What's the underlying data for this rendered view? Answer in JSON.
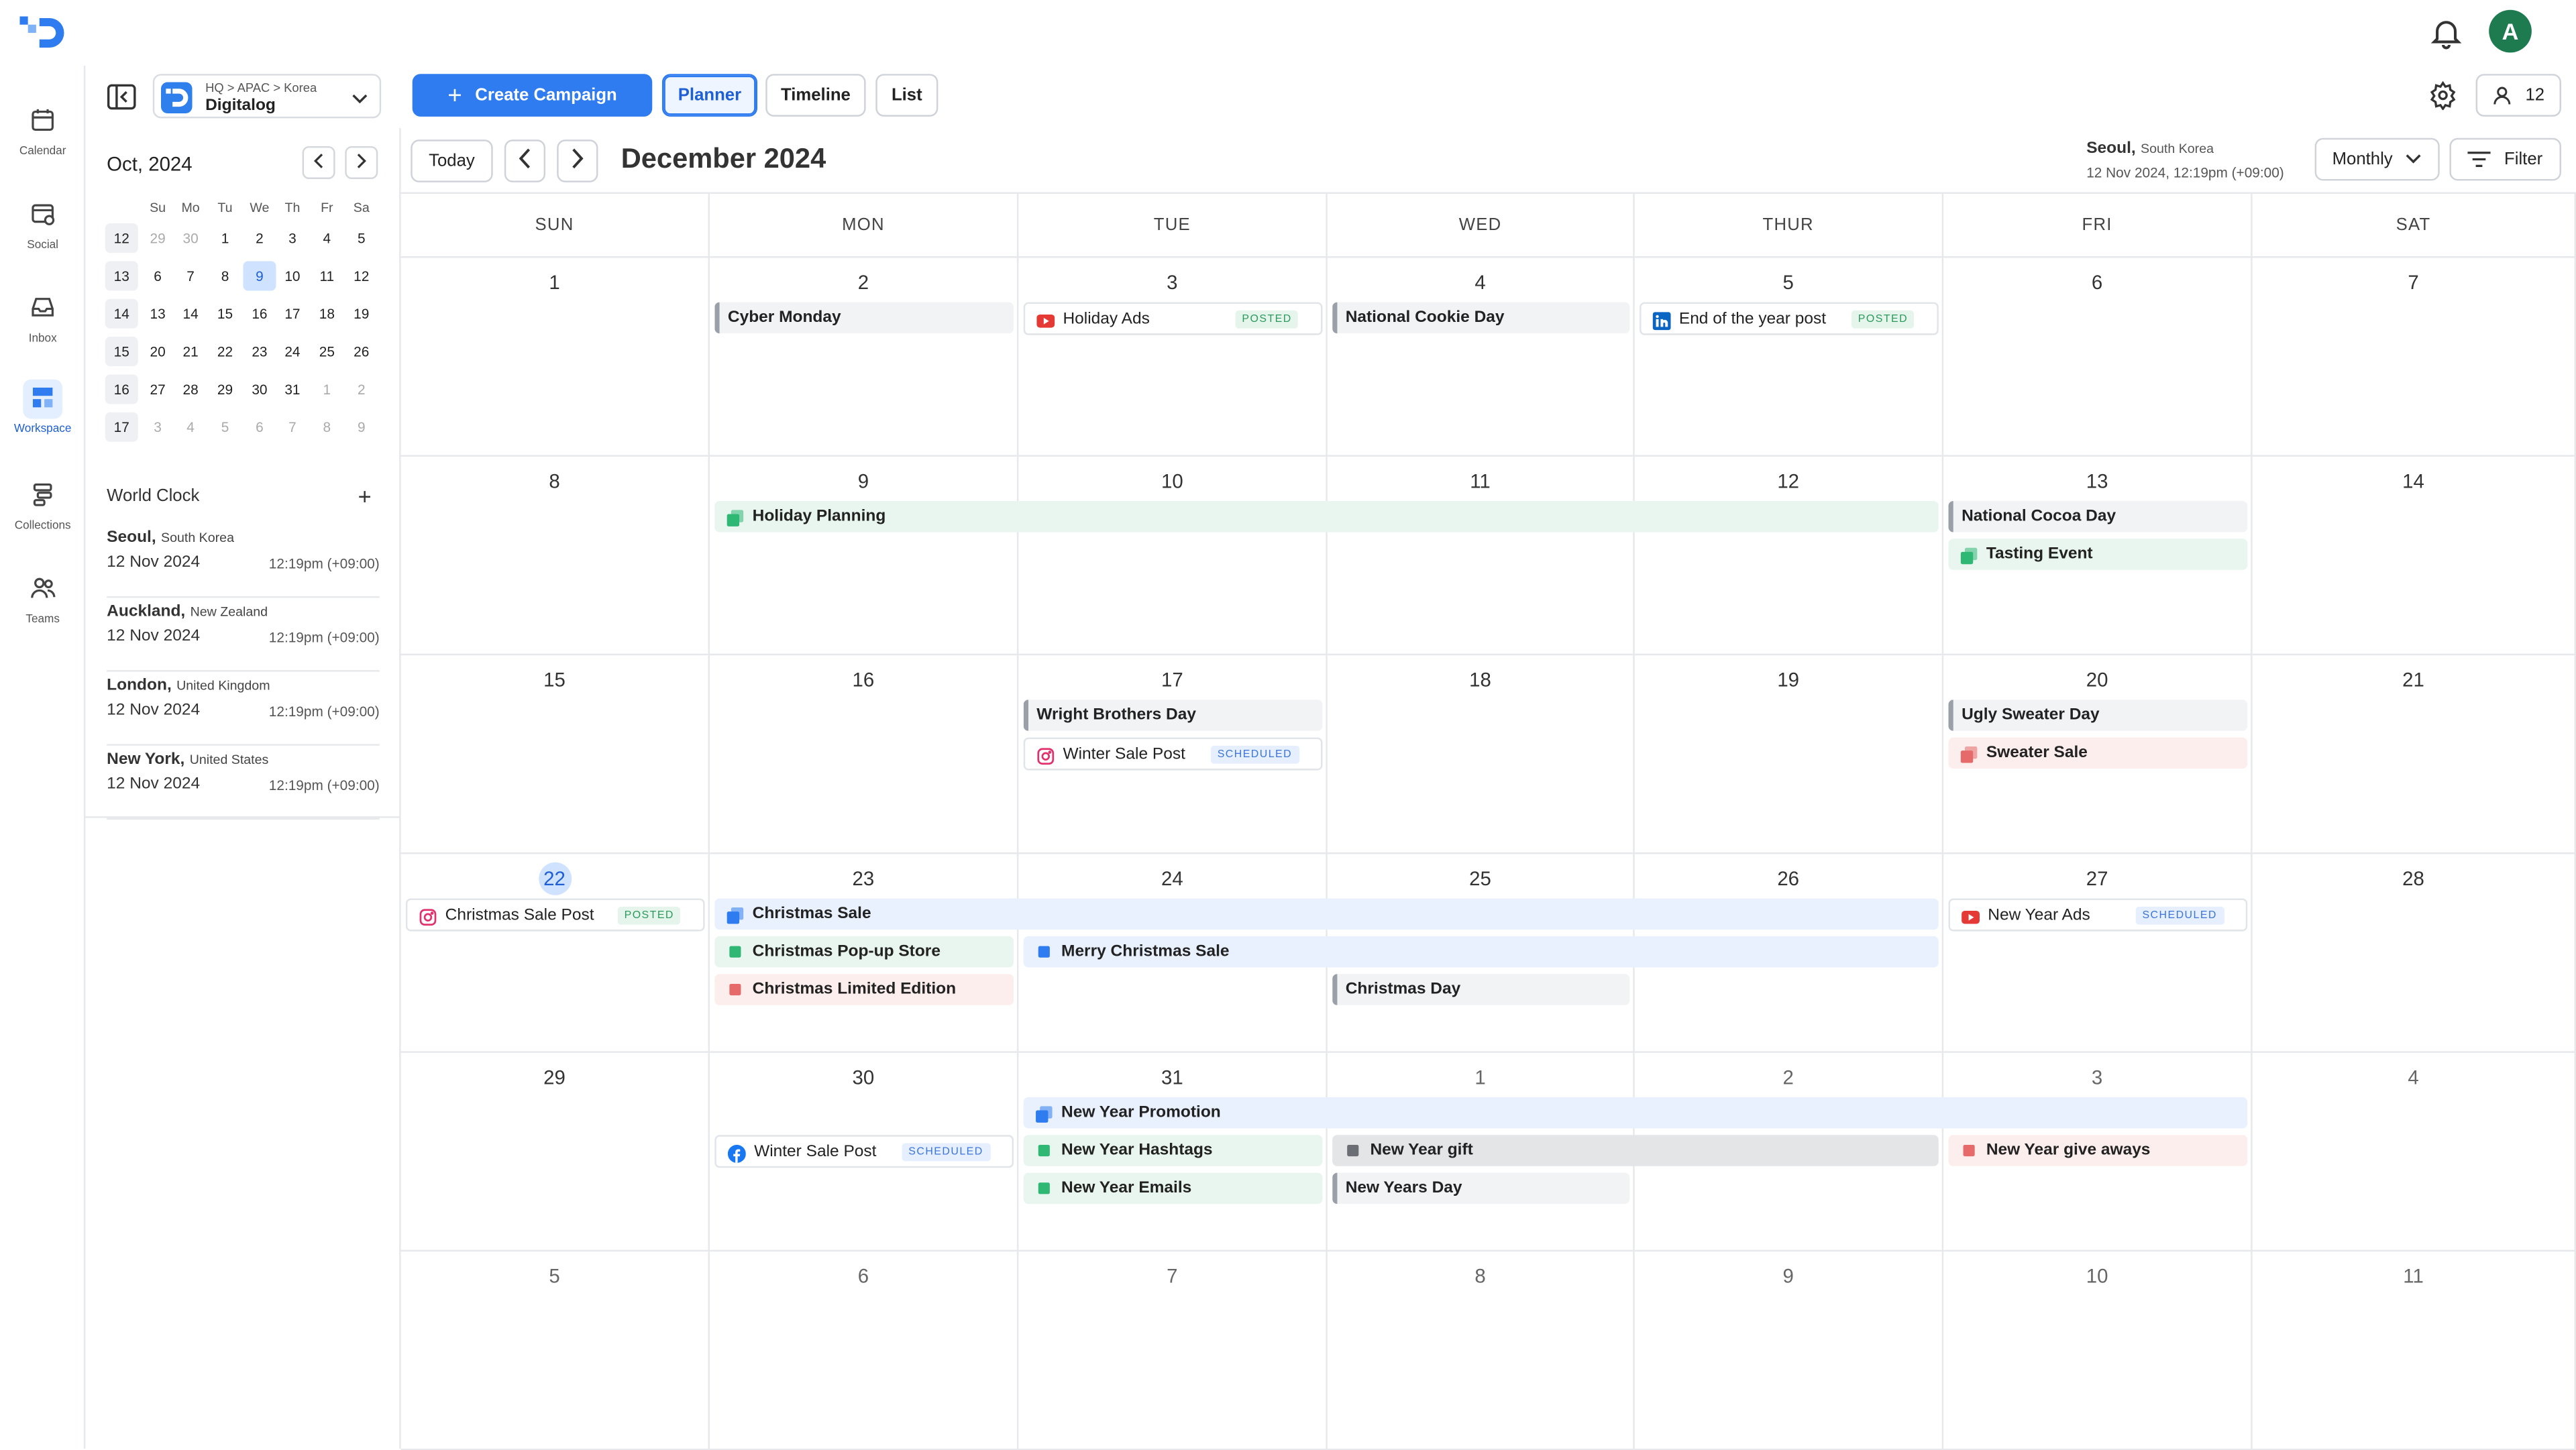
{
  "topbar": {
    "avatar_letter": "A"
  },
  "rail": [
    {
      "label": "Calendar",
      "icon": "calendar-icon"
    },
    {
      "label": "Social",
      "icon": "social-icon"
    },
    {
      "label": "Inbox",
      "icon": "inbox-icon"
    },
    {
      "label": "Workspace",
      "icon": "workspace-icon",
      "active": true
    },
    {
      "label": "Collections",
      "icon": "collections-icon"
    },
    {
      "label": "Teams",
      "icon": "teams-icon"
    }
  ],
  "toolbar": {
    "org_path": "HQ > APAC > Korea",
    "org_name": "Digitalog",
    "create_label": "Create Campaign",
    "views": [
      "Planner",
      "Timeline",
      "List"
    ],
    "active_view": "Planner",
    "member_count": "12"
  },
  "mini_calendar": {
    "title": "Oct, 2024",
    "weekdays": [
      "Su",
      "Mo",
      "Tu",
      "We",
      "Th",
      "Fr",
      "Sa"
    ],
    "weeks": [
      {
        "week": "12",
        "days": [
          "29",
          "30",
          "1",
          "2",
          "3",
          "4",
          "5"
        ]
      },
      {
        "week": "13",
        "days": [
          "6",
          "7",
          "8",
          "9",
          "10",
          "11",
          "12"
        ]
      },
      {
        "week": "14",
        "days": [
          "13",
          "14",
          "15",
          "16",
          "17",
          "18",
          "19"
        ]
      },
      {
        "week": "15",
        "days": [
          "20",
          "21",
          "22",
          "23",
          "24",
          "25",
          "26"
        ]
      },
      {
        "week": "16",
        "days": [
          "27",
          "28",
          "29",
          "30",
          "31",
          "1",
          "2"
        ]
      },
      {
        "week": "17",
        "days": [
          "3",
          "4",
          "5",
          "6",
          "7",
          "8",
          "9"
        ]
      }
    ],
    "selected": "9"
  },
  "world_clock": {
    "title": "World Clock",
    "entries": [
      {
        "city": "Seoul,",
        "country": "South Korea",
        "date": "12 Nov 2024",
        "time": "12:19pm  (+09:00)"
      },
      {
        "city": "Auckland,",
        "country": "New Zealand",
        "date": "12 Nov 2024",
        "time": "12:19pm  (+09:00)"
      },
      {
        "city": "London,",
        "country": "United Kingdom",
        "date": "12 Nov 2024",
        "time": "12:19pm  (+09:00)"
      },
      {
        "city": "New York,",
        "country": "United States",
        "date": "12 Nov 2024",
        "time": "12:19pm  (+09:00)"
      }
    ]
  },
  "calendar": {
    "today_label": "Today",
    "title": "December  2024",
    "tz_city": "Seoul,",
    "tz_country": "South Korea",
    "tz_datetime": "12 Nov 2024,  12:19pm  (+09:00)",
    "view_select": "Monthly",
    "filter_label": "Filter",
    "days": [
      "SUN",
      "MON",
      "TUE",
      "WED",
      "THUR",
      "FRI",
      "SAT"
    ],
    "weeks": [
      [
        "1",
        "2",
        "3",
        "4",
        "5",
        "6",
        "7"
      ],
      [
        "8",
        "9",
        "10",
        "11",
        "12",
        "13",
        "14"
      ],
      [
        "15",
        "16",
        "17",
        "18",
        "19",
        "20",
        "21"
      ],
      [
        "22",
        "23",
        "24",
        "25",
        "26",
        "27",
        "28"
      ],
      [
        "29",
        "30",
        "31",
        "1",
        "2",
        "3",
        "4"
      ],
      [
        "5",
        "6",
        "7",
        "8",
        "9",
        "10",
        "11"
      ]
    ],
    "today": "22",
    "events": [
      {
        "week": 0,
        "start": 1,
        "span": 1,
        "slot": 0,
        "type": "holiday",
        "label": "Cyber Monday"
      },
      {
        "week": 0,
        "start": 2,
        "span": 1,
        "slot": 0,
        "type": "post",
        "icon": "youtube-icon",
        "label": "Holiday Ads",
        "status": "POSTED"
      },
      {
        "week": 0,
        "start": 3,
        "span": 1,
        "slot": 0,
        "type": "holiday",
        "label": "National Cookie Day"
      },
      {
        "week": 0,
        "start": 4,
        "span": 1,
        "slot": 0,
        "type": "post",
        "icon": "linkedin-icon",
        "label": "End of the year post",
        "status": "POSTED"
      },
      {
        "week": 1,
        "start": 1,
        "span": 4,
        "slot": 0,
        "type": "green",
        "icon": "campaign-icon",
        "label": "Holiday Planning"
      },
      {
        "week": 1,
        "start": 5,
        "span": 1,
        "slot": 0,
        "type": "holiday",
        "label": "National Cocoa Day"
      },
      {
        "week": 1,
        "start": 5,
        "span": 1,
        "slot": 1,
        "type": "green",
        "icon": "campaign-icon",
        "label": "Tasting Event"
      },
      {
        "week": 2,
        "start": 2,
        "span": 1,
        "slot": 0,
        "type": "holiday",
        "label": "Wright Brothers Day"
      },
      {
        "week": 2,
        "start": 2,
        "span": 1,
        "slot": 1,
        "type": "post",
        "icon": "instagram-icon",
        "label": "Winter Sale Post",
        "status": "SCHEDULED"
      },
      {
        "week": 2,
        "start": 5,
        "span": 1,
        "slot": 0,
        "type": "holiday",
        "label": "Ugly Sweater Day"
      },
      {
        "week": 2,
        "start": 5,
        "span": 1,
        "slot": 1,
        "type": "red",
        "icon": "campaign-icon",
        "label": "Sweater Sale"
      },
      {
        "week": 3,
        "start": 0,
        "span": 1,
        "slot": 0,
        "type": "post",
        "icon": "instagram-icon",
        "label": "Christmas Sale Post",
        "status": "POSTED"
      },
      {
        "week": 3,
        "start": 1,
        "span": 4,
        "slot": 0,
        "type": "blue",
        "icon": "campaign-icon",
        "label": "Christmas Sale"
      },
      {
        "week": 3,
        "start": 5,
        "span": 1,
        "slot": 0,
        "type": "post",
        "icon": "youtube-icon",
        "label": "New Year Ads",
        "status": "SCHEDULED"
      },
      {
        "week": 3,
        "start": 1,
        "span": 1,
        "slot": 1,
        "type": "green",
        "icon": "square-icon",
        "label": "Christmas Pop-up Store"
      },
      {
        "week": 3,
        "start": 2,
        "span": 3,
        "slot": 1,
        "type": "blue",
        "icon": "square-icon",
        "label": "Merry Christmas Sale"
      },
      {
        "week": 3,
        "start": 1,
        "span": 1,
        "slot": 2,
        "type": "red",
        "icon": "square-icon",
        "label": "Christmas Limited Edition"
      },
      {
        "week": 3,
        "start": 3,
        "span": 1,
        "slot": 2,
        "type": "holiday",
        "label": "Christmas Day"
      },
      {
        "week": 4,
        "start": 1,
        "span": 1,
        "slot": 1,
        "type": "post",
        "icon": "facebook-icon",
        "label": "Winter Sale Post",
        "status": "SCHEDULED"
      },
      {
        "week": 4,
        "start": 2,
        "span": 4,
        "slot": 0,
        "type": "blue",
        "icon": "campaign-icon",
        "label": "New Year Promotion"
      },
      {
        "week": 4,
        "start": 2,
        "span": 1,
        "slot": 1,
        "type": "green",
        "icon": "square-icon",
        "label": "New Year Hashtags"
      },
      {
        "week": 4,
        "start": 3,
        "span": 2,
        "slot": 1,
        "type": "gray",
        "icon": "square-icon",
        "label": "New Year gift"
      },
      {
        "week": 4,
        "start": 5,
        "span": 1,
        "slot": 1,
        "type": "red",
        "icon": "square-icon",
        "label": "New Year give aways"
      },
      {
        "week": 4,
        "start": 2,
        "span": 1,
        "slot": 2,
        "type": "green",
        "icon": "square-icon",
        "label": "New Year Emails"
      },
      {
        "week": 4,
        "start": 3,
        "span": 1,
        "slot": 2,
        "type": "holiday",
        "label": "New Years Day"
      }
    ]
  },
  "colors": {
    "accent": "#2f7bf0",
    "green": "#2fb774",
    "blue": "#2f7bf0",
    "red": "#e66a6a",
    "gray": "#6b6f75",
    "avatar": "#1e7a4f"
  }
}
